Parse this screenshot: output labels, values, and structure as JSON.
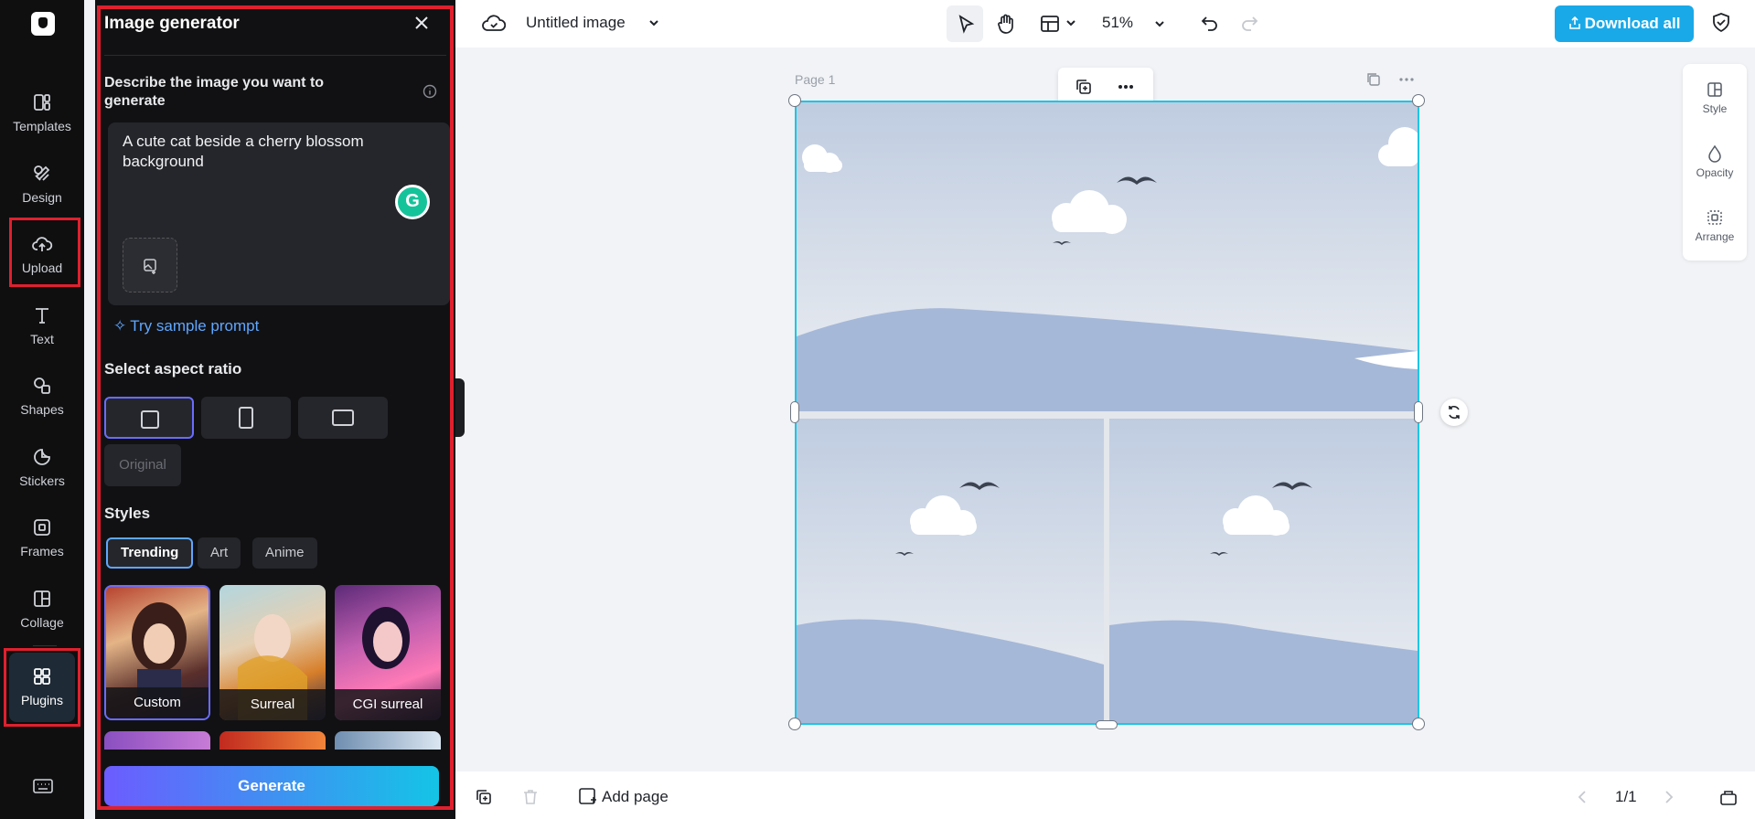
{
  "nav": {
    "items": [
      {
        "label": "Templates",
        "icon": "templates-icon"
      },
      {
        "label": "Design",
        "icon": "design-icon"
      },
      {
        "label": "Upload",
        "icon": "upload-cloud-icon"
      },
      {
        "label": "Text",
        "icon": "text-icon"
      },
      {
        "label": "Shapes",
        "icon": "shapes-icon"
      },
      {
        "label": "Stickers",
        "icon": "stickers-icon"
      },
      {
        "label": "Frames",
        "icon": "frames-icon"
      },
      {
        "label": "Collage",
        "icon": "collage-icon"
      },
      {
        "label": "Plugins",
        "icon": "plugins-icon"
      }
    ],
    "active": "Plugins"
  },
  "panel": {
    "title": "Image generator",
    "describe_label": "Describe the image you want to generate",
    "prompt_value": "A cute cat beside a cherry blossom background",
    "sample_prompt": "Try sample prompt",
    "aspect_label": "Select aspect ratio",
    "aspect_original": "Original",
    "styles_label": "Styles",
    "style_tabs": [
      "Trending",
      "Art",
      "Anime"
    ],
    "style_cards": [
      "Custom",
      "Surreal",
      "CGI surreal"
    ],
    "generate": "Generate",
    "grammarly_letter": "G"
  },
  "topbar": {
    "title": "Untitled image",
    "zoom": "51%",
    "download": "Download all"
  },
  "canvas": {
    "page_label": "Page 1"
  },
  "props": {
    "style": "Style",
    "opacity": "Opacity",
    "arrange": "Arrange"
  },
  "bottombar": {
    "add_page": "Add page",
    "page_count": "1/1"
  },
  "colors": {
    "accent": "#19a9e8",
    "highlight": "#e0202e",
    "selection": "#1cc6e6"
  }
}
